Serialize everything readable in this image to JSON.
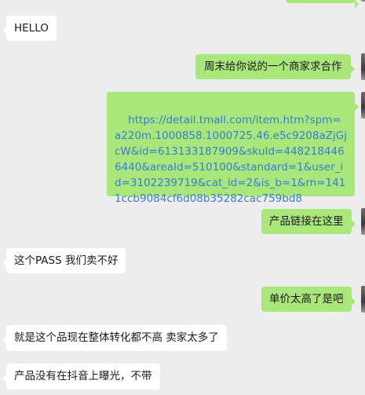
{
  "messages": [
    {
      "side": "right",
      "text": ""
    },
    {
      "side": "left",
      "text": "HELLO"
    },
    {
      "side": "right",
      "text": "周末给你说的一个商家求合作"
    },
    {
      "side": "right",
      "text": "https://detail.tmall.com/item.htm?spm=a220m.1000858.1000725.46.e5c9208aZjGjcW&id=613133187909&skuId=4482184466440&areaId=510100&standard=1&user_id=3102239719&cat_id=2&is_b=1&rn=1411ccb9084cf6d08b35282cac759bd8"
    },
    {
      "side": "right",
      "text": "产品链接在这里"
    },
    {
      "side": "left",
      "text": "这个PASS 我们卖不好"
    },
    {
      "side": "right",
      "text": "单价太高了是吧"
    },
    {
      "side": "left",
      "text": "就是这个品现在整体转化都不高 卖家太多了"
    },
    {
      "side": "left",
      "text": "产品没有在抖音上曝光，不带"
    }
  ],
  "colors": {
    "background": "#ededed",
    "left_bubble": "#ffffff",
    "right_bubble": "#a9e77a",
    "link": "#3a7bd5"
  }
}
